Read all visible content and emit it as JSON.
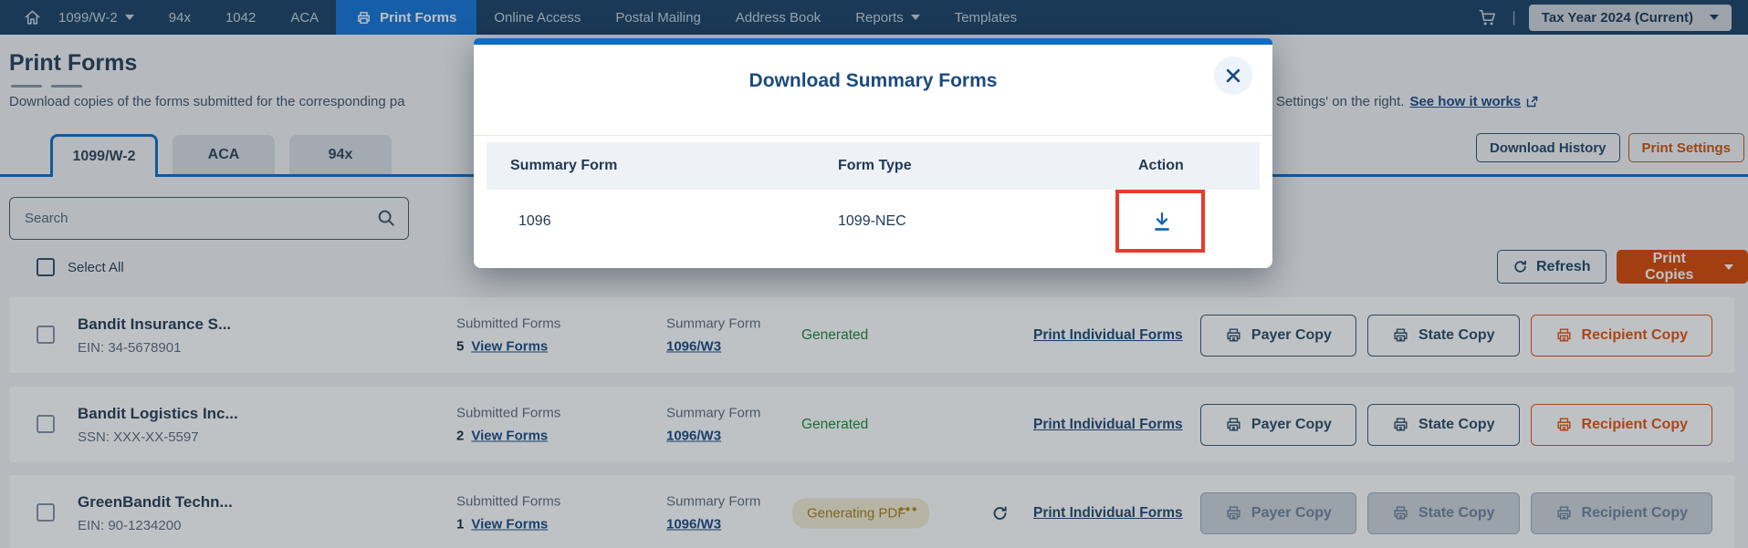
{
  "colors": {
    "nav_bg": "#1d4468",
    "nav_active": "#1878d8",
    "accent_blue": "#1470c5",
    "accent_orange": "#d84a08",
    "outline_orange": "#e15512",
    "navy_text": "#27415c",
    "green_status": "#1f8b3e",
    "amber_status": "#a8821a",
    "highlight_red": "#e83a2e"
  },
  "nav": {
    "items": [
      {
        "label": "1099/W-2"
      },
      {
        "label": "94x"
      },
      {
        "label": "1042"
      },
      {
        "label": "ACA"
      },
      {
        "label": "Print Forms"
      },
      {
        "label": "Online Access"
      },
      {
        "label": "Postal Mailing"
      },
      {
        "label": "Address Book"
      },
      {
        "label": "Reports"
      },
      {
        "label": "Templates"
      }
    ],
    "divider": "|",
    "tax_year_label": "Tax Year 2024 (Current)"
  },
  "header": {
    "title": "Print Forms",
    "description_left": "Download copies of the forms submitted for the corresponding pa",
    "description_right": "Settings' on the right.",
    "see_how_link": "See how it works"
  },
  "tabs": [
    {
      "label": "1099/W-2"
    },
    {
      "label": "ACA"
    },
    {
      "label": "94x"
    }
  ],
  "toolbar": {
    "download_history": "Download History",
    "print_settings": "Print Settings",
    "search_placeholder": "Search",
    "select_all": "Select All",
    "refresh": "Refresh",
    "print_copies": "Print Copies"
  },
  "modal": {
    "title": "Download Summary Forms",
    "columns": {
      "summary_form": "Summary Form",
      "form_type": "Form Type",
      "action": "Action"
    },
    "row": {
      "summary_form": "1096",
      "form_type": "1099-NEC",
      "action_icon": "download-icon"
    }
  },
  "table": {
    "labels": {
      "submitted_forms": "Submitted Forms",
      "view_forms": "View Forms",
      "summary_form": "Summary Form",
      "print_individual": "Print Individual Forms",
      "payer_copy": "Payer Copy",
      "state_copy": "State Copy",
      "recipient_copy": "Recipient Copy",
      "generating_dots": "•••"
    },
    "rows": [
      {
        "name": "Bandit Insurance S...",
        "id_label": "EIN: 34-5678901",
        "submitted_count": "5",
        "summary_link": "1096/W3",
        "status": "Generated"
      },
      {
        "name": "Bandit Logistics Inc...",
        "id_label": "SSN: XXX-XX-5597",
        "submitted_count": "2",
        "summary_link": "1096/W3",
        "status": "Generated"
      },
      {
        "name": "GreenBandit Techn...",
        "id_label": "EIN: 90-1234200",
        "submitted_count": "1",
        "summary_link": "1096/W3",
        "status": "Generating PDF"
      }
    ]
  }
}
